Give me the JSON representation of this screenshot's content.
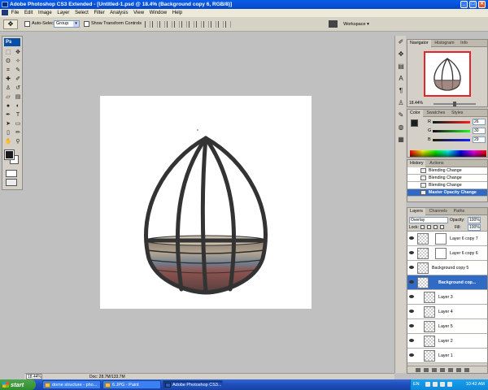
{
  "window": {
    "title": "Adobe Photoshop CS3 Extended - [Untitled-1.psd @ 18.4% (Background copy 6, RGB/8)]",
    "minimize": "_",
    "maximize": "□",
    "close": "✕"
  },
  "menu": [
    "File",
    "Edit",
    "Image",
    "Layer",
    "Select",
    "Filter",
    "Analysis",
    "View",
    "Window",
    "Help"
  ],
  "options": {
    "auto_select_label": "Auto-Select:",
    "auto_select_value": "Group",
    "show_transform_label": "Show Transform Controls",
    "workspace_label": "Workspace ▾"
  },
  "toolbox": {
    "logo": "Ps"
  },
  "navigator": {
    "tabs": [
      "Navigator",
      "Histogram",
      "Info"
    ],
    "zoom": "18.44%"
  },
  "color_panel": {
    "tabs": [
      "Color",
      "Swatches",
      "Styles"
    ],
    "channels": [
      {
        "label": "R",
        "value": "26"
      },
      {
        "label": "G",
        "value": "30"
      },
      {
        "label": "B",
        "value": "29"
      }
    ]
  },
  "history": {
    "tabs": [
      "History",
      "Actions"
    ],
    "items": [
      "Blending Change",
      "Blending Change",
      "Blending Change",
      "Master Opacity Change"
    ]
  },
  "layers": {
    "tabs": [
      "Layers",
      "Channels",
      "Paths"
    ],
    "blend_mode": "Overlay",
    "opacity_label": "Opacity:",
    "opacity": "100%",
    "lock_label": "Lock:",
    "fill_label": "Fill:",
    "fill": "100%",
    "items": [
      {
        "name": "Layer 6 copy 7",
        "mask": true,
        "active": false
      },
      {
        "name": "Layer 6 copy 6",
        "mask": true,
        "active": false
      },
      {
        "name": "Background copy 5",
        "mask": false,
        "active": false
      },
      {
        "name": "Background cop...",
        "mask": false,
        "active": true
      },
      {
        "name": "Layer 3",
        "mask": false,
        "active": false
      },
      {
        "name": "Layer 4",
        "mask": false,
        "active": false
      },
      {
        "name": "Layer 5",
        "mask": false,
        "active": false
      },
      {
        "name": "Layer 2",
        "mask": false,
        "active": false
      },
      {
        "name": "Layer 1",
        "mask": false,
        "active": false
      }
    ]
  },
  "status": {
    "zoom": "18.44%",
    "doc": "Doc: 28.7M/133.7M"
  },
  "taskbar": {
    "start": "start",
    "tasks": [
      {
        "label": "dome structure - pho...",
        "active": false
      },
      {
        "label": "6.JPG - Paint",
        "active": false
      },
      {
        "label": "Adobe Photoshop CS3...",
        "active": true
      }
    ],
    "lang": "EN",
    "clock": "10:42 AM"
  }
}
